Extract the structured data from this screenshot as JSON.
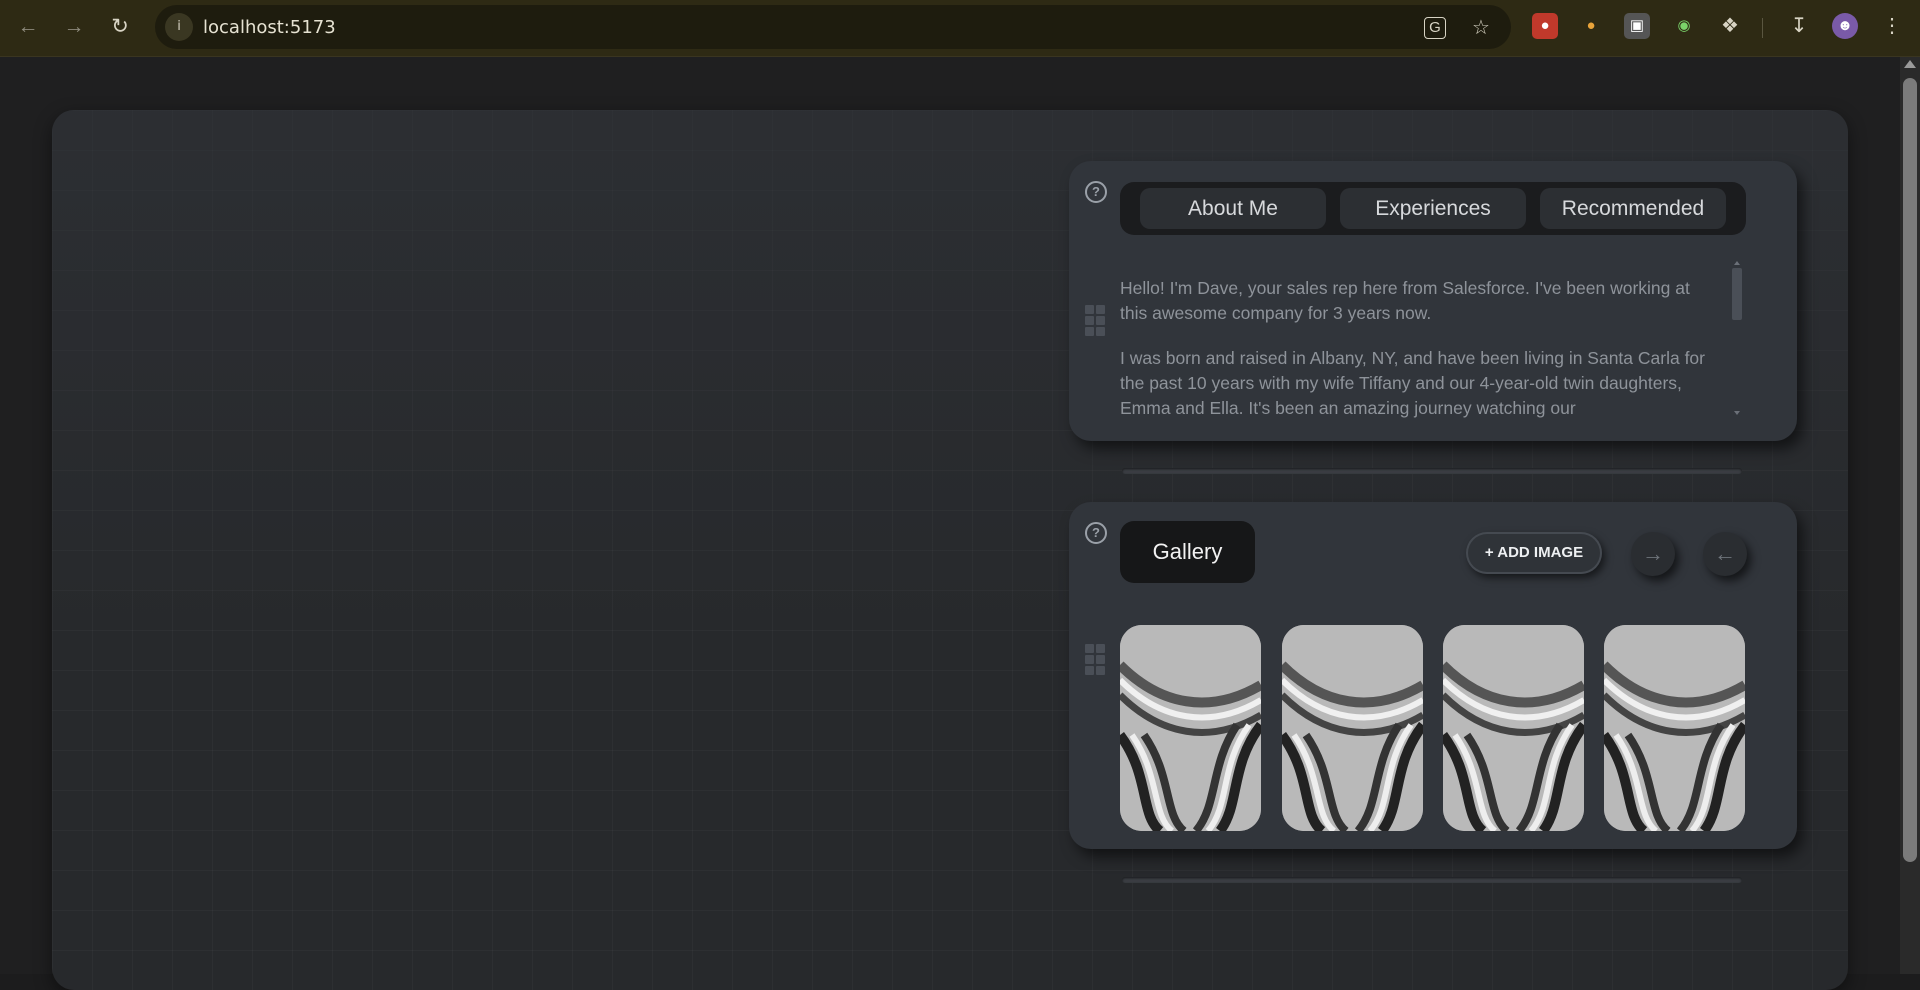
{
  "browser": {
    "url": "localhost:5173",
    "icons": [
      "back-arrow-icon",
      "forward-arrow-icon",
      "reload-icon",
      "site-info-icon",
      "translate-icon",
      "bookmark-star-icon",
      "extensions-puzzle-icon",
      "download-icon",
      "profile-avatar",
      "kebab-menu-icon"
    ]
  },
  "about_widget": {
    "tabs": [
      "About Me",
      "Experiences",
      "Recommended"
    ],
    "paragraphs": [
      "Hello! I'm Dave, your sales rep here from Salesforce. I've been working at this awesome company for 3 years now.",
      "I was born and raised in Albany, NY, and have been living in Santa Carla for the past 10 years with my wife Tiffany and our 4-year-old twin daughters, Emma and Ella. It's been an amazing journey watching our"
    ]
  },
  "gallery_widget": {
    "title": "Gallery",
    "add_button": "+ ADD IMAGE",
    "images": [
      "architecture-photo",
      "architecture-photo",
      "architecture-photo",
      "architecture-photo"
    ]
  },
  "colors": {
    "browser_frame": "#2e2a14",
    "page_background": "#1f1f20",
    "widget_background": "#31353b",
    "tab_bar": "#1b1c1e",
    "text_muted": "#8e939a"
  }
}
